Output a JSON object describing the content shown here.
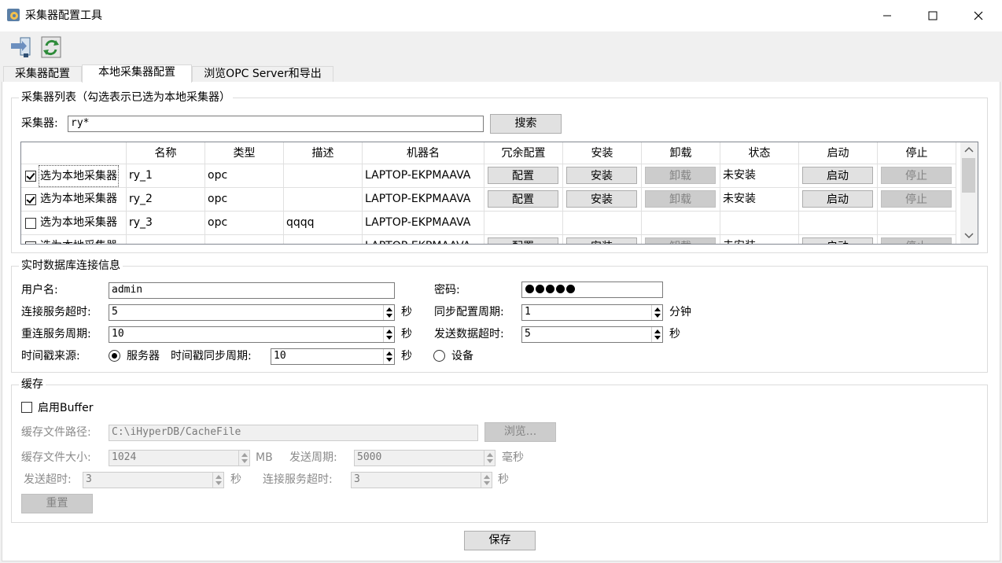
{
  "window": {
    "title": "采集器配置工具"
  },
  "tabs": [
    "采集器配置",
    "本地采集器配置",
    "浏览OPC Server和导出"
  ],
  "collector_list": {
    "group_title": "采集器列表（勾选表示已选为本地采集器）",
    "search_label": "采集器:",
    "search_value": "ry*",
    "search_button": "搜索",
    "columns": [
      "",
      "名称",
      "类型",
      "描述",
      "机器名",
      "冗余配置",
      "安装",
      "卸载",
      "状态",
      "启动",
      "停止"
    ],
    "select_label": "选为本地采集器",
    "rows": [
      {
        "checked": true,
        "name": "ry_1",
        "type": "opc",
        "desc": "",
        "machine": "LAPTOP-EKPMAAVA",
        "config_btn": "配置",
        "install_btn": "安装",
        "uninstall_btn": "卸载",
        "status": "未安装",
        "start_btn": "启动",
        "stop_btn": "停止"
      },
      {
        "checked": true,
        "name": "ry_2",
        "type": "opc",
        "desc": "",
        "machine": "LAPTOP-EKPMAAVA",
        "config_btn": "配置",
        "install_btn": "安装",
        "uninstall_btn": "卸载",
        "status": "未安装",
        "start_btn": "启动",
        "stop_btn": "停止"
      },
      {
        "checked": false,
        "name": "ry_3",
        "type": "opc",
        "desc": "qqqq",
        "machine": "LAPTOP-EKPMAAVA"
      }
    ]
  },
  "db_conn": {
    "group_title": "实时数据库连接信息",
    "username_label": "用户名:",
    "username_value": "admin",
    "password_label": "密码:",
    "password_length": 5,
    "connect_timeout_label": "连接服务超时:",
    "connect_timeout_value": "5",
    "connect_timeout_unit": "秒",
    "sync_period_label": "同步配置周期:",
    "sync_period_value": "1",
    "sync_period_unit": "分钟",
    "reconnect_label": "重连服务周期:",
    "reconnect_value": "10",
    "reconnect_unit": "秒",
    "send_timeout_label": "发送数据超时:",
    "send_timeout_value": "5",
    "send_timeout_unit": "秒",
    "ts_source_label": "时间戳来源:",
    "ts_server_label": "服务器",
    "ts_sync_label": "时间戳同步周期:",
    "ts_sync_value": "10",
    "ts_sync_unit": "秒",
    "ts_device_label": "设备",
    "ts_source_selected": "服务器"
  },
  "cache": {
    "group_title": "缓存",
    "enable_label": "启用Buffer",
    "enabled": false,
    "path_label": "缓存文件路径:",
    "path_value": "C:\\iHyperDB/CacheFile",
    "browse_button": "浏览...",
    "size_label": "缓存文件大小:",
    "size_value": "1024",
    "size_unit": "MB",
    "send_period_label": "发送周期:",
    "send_period_value": "5000",
    "send_period_unit": "毫秒",
    "send_timeout_label": "发送超时:",
    "send_timeout_value": "3",
    "send_timeout_unit": "秒",
    "conn_timeout_label": "连接服务超时:",
    "conn_timeout_value": "3",
    "conn_timeout_unit": "秒",
    "reset_button": "重置"
  },
  "save_button": "保存"
}
